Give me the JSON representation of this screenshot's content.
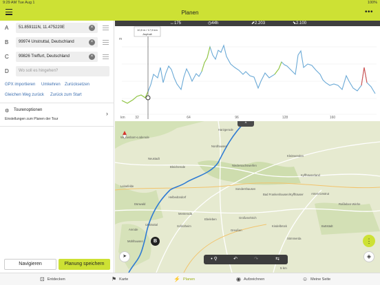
{
  "status": {
    "time": "9:29 AM",
    "date": "Tue Aug 1",
    "battery": "100%"
  },
  "header": {
    "title": "Planen",
    "menu_icon": "hamburger-icon",
    "more_icon": "more-icon"
  },
  "waypoints": [
    {
      "letter": "A",
      "value": "51.859111N, 11.475220E"
    },
    {
      "letter": "B",
      "value": "99974 Unstruttal, Deutschland"
    },
    {
      "letter": "C",
      "value": "99826 Treffurt, Deutschland"
    },
    {
      "letter": "D",
      "placeholder": "Wo soll es hingehen?"
    }
  ],
  "actions": {
    "gpx_import": "GPX importieren",
    "reverse": "Umkehren",
    "reset": "Zurücksetzen",
    "same_way_back": "Gleichen Weg zurück",
    "back_to_start": "Zurück zum Start"
  },
  "tour_options": {
    "title": "Tourenoptionen",
    "subtitle": "Einstellungen zum Planen der Tour"
  },
  "buttons": {
    "navigate": "Navigieren",
    "save": "Planung speichern"
  },
  "elevation": {
    "distance": "175 km",
    "duration": "44h 51min",
    "ascent": "2.203 m",
    "descent": "2.100 m",
    "y_unit": "m",
    "x_unit": "km",
    "x_ticks": [
      "0",
      "32",
      "64",
      "96",
      "128",
      "160"
    ],
    "tooltip_line1": "10,5 m / 17,5 km",
    "tooltip_line2": "Asphalt",
    "accent_color": "#cde134"
  },
  "map": {
    "places": [
      "Harzgerode",
      "Weißenborn-Lüderode",
      "Nordhausen",
      "Neustadt",
      "Kleinwenden",
      "Niedersachswerfen",
      "Bleicherode",
      "Kyffhäuserland",
      "Sondershausen",
      "Bad Frankenhausen/Kyffhäuser",
      "Artern/Unstrut",
      "Roßleben-Wiehe",
      "Leinefelde",
      "Helbedündorf",
      "Ebeleben",
      "Greußen",
      "Sömmerda",
      "Mühlhausen",
      "Unstruttal",
      "Schlotheim",
      "Kindelbrück",
      "Buttstädt",
      "Großenehrich",
      "Dünwald",
      "Anrode",
      "Menteroda",
      "Greußen"
    ],
    "collapse_label": "^",
    "marker_b": "B",
    "scale": "5 km",
    "controls": [
      "undo",
      "redo",
      "route"
    ]
  },
  "tabs": [
    {
      "label": "Entdecken",
      "icon": "discover-icon"
    },
    {
      "label": "Karte",
      "icon": "map-icon"
    },
    {
      "label": "Planen",
      "icon": "plan-icon",
      "active": true
    },
    {
      "label": "Aufzeichnen",
      "icon": "record-icon"
    },
    {
      "label": "Meine Seite",
      "icon": "profile-icon"
    }
  ]
}
